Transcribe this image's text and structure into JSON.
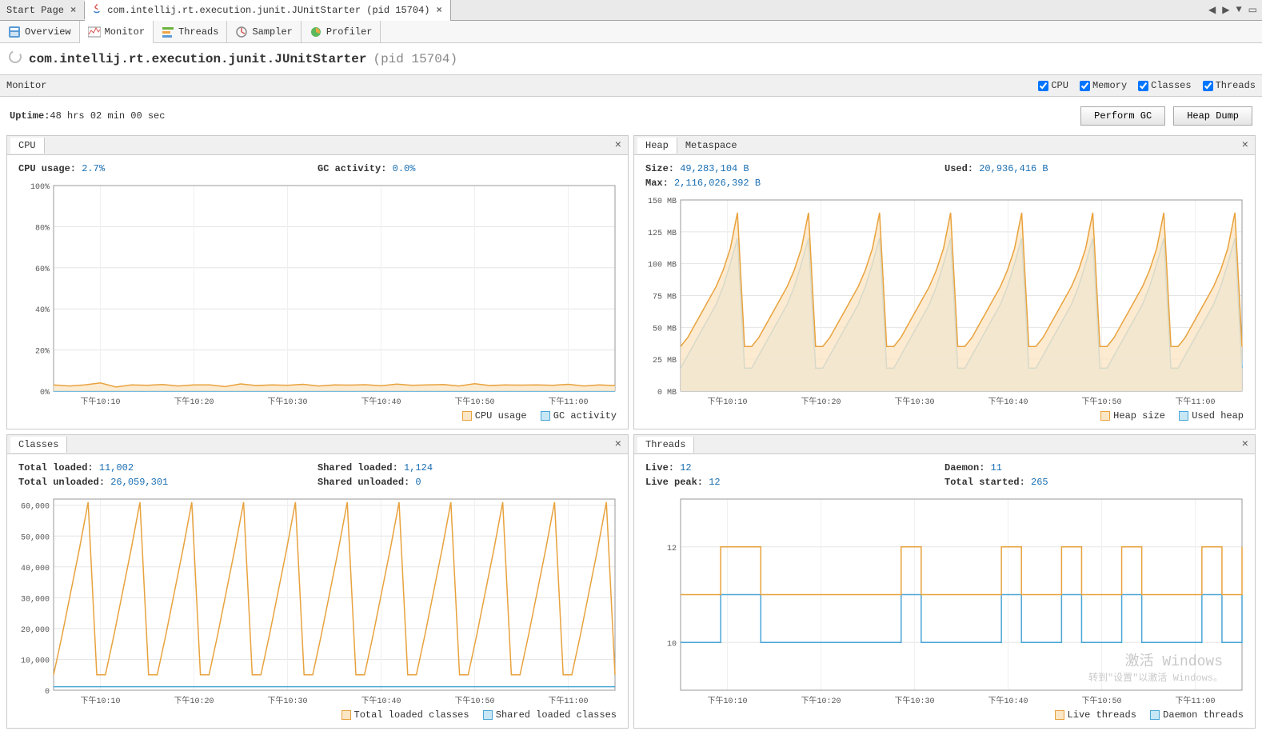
{
  "top_tabs": {
    "start_page": "Start Page",
    "main": "com.intellij.rt.execution.junit.JUnitStarter (pid 15704)"
  },
  "tool_tabs": {
    "overview": "Overview",
    "monitor": "Monitor",
    "threads": "Threads",
    "sampler": "Sampler",
    "profiler": "Profiler"
  },
  "title": {
    "name": "com.intellij.rt.execution.junit.JUnitStarter",
    "pid": "(pid 15704)"
  },
  "monitor_bar": {
    "label": "Monitor",
    "cpu": "CPU",
    "memory": "Memory",
    "classes": "Classes",
    "threads": "Threads"
  },
  "uptime": {
    "label": "Uptime: ",
    "value": "48 hrs 02 min 00 sec"
  },
  "buttons": {
    "gc": "Perform GC",
    "dump": "Heap Dump"
  },
  "panel_cpu": {
    "title": "CPU",
    "cpu_usage_label": "CPU usage: ",
    "cpu_usage_value": "2.7%",
    "gc_label": "GC activity: ",
    "gc_value": "0.0%",
    "legend_cpu": "CPU usage",
    "legend_gc": "GC activity"
  },
  "panel_heap": {
    "tab_heap": "Heap",
    "tab_meta": "Metaspace",
    "size_label": "Size: ",
    "size_value": "49,283,104 B",
    "used_label": "Used: ",
    "used_value": "20,936,416 B",
    "max_label": "Max: ",
    "max_value": "2,116,026,392 B",
    "legend_size": "Heap size",
    "legend_used": "Used heap"
  },
  "panel_classes": {
    "title": "Classes",
    "tl_label": "Total loaded: ",
    "tl_value": "11,002",
    "sl_label": "Shared loaded: ",
    "sl_value": "1,124",
    "tu_label": "Total unloaded: ",
    "tu_value": "26,059,301",
    "su_label": "Shared unloaded: ",
    "su_value": "0",
    "legend_total": "Total loaded classes",
    "legend_shared": "Shared loaded classes"
  },
  "panel_threads": {
    "title": "Threads",
    "live_label": "Live: ",
    "live_value": "12",
    "daemon_label": "Daemon: ",
    "daemon_value": "11",
    "peak_label": "Live peak: ",
    "peak_value": "12",
    "started_label": "Total started: ",
    "started_value": "265",
    "legend_live": "Live threads",
    "legend_daemon": "Daemon threads"
  },
  "watermark": {
    "l1": "激活 Windows",
    "l2": "转到\"设置\"以激活 Windows。"
  },
  "chart_data": [
    {
      "id": "cpu",
      "type": "line",
      "xlabel": "",
      "ylabel": "",
      "x_ticks": [
        "下午10:10",
        "下午10:20",
        "下午10:30",
        "下午10:40",
        "下午10:50",
        "下午11:00"
      ],
      "y_ticks": [
        0,
        20,
        40,
        60,
        80,
        100
      ],
      "y_suffix": "%",
      "ylim": [
        0,
        100
      ],
      "series": [
        {
          "name": "CPU usage",
          "color": "#e8a23d",
          "fill": "#fbe6c5",
          "values": [
            3,
            2.5,
            3,
            4,
            2,
            3,
            2.8,
            3.2,
            2.5,
            3,
            3,
            2.2,
            3.5,
            2.7,
            3,
            2.8,
            3.3,
            2.5,
            3,
            2.9,
            3.1,
            2.6,
            3.4,
            2.8,
            3,
            3.2,
            2.5,
            3.6,
            2.7,
            3,
            2.9,
            3,
            2.8,
            3.3,
            2.5,
            3,
            2.7
          ]
        },
        {
          "name": "GC activity",
          "color": "#4aa6d6",
          "fill": "#c7e7f6",
          "values": [
            0,
            0,
            0,
            0,
            0,
            0,
            0,
            0,
            0,
            0,
            0,
            0,
            0,
            0,
            0,
            0,
            0,
            0,
            0,
            0,
            0,
            0,
            0,
            0,
            0,
            0,
            0,
            0,
            0,
            0,
            0,
            0,
            0,
            0,
            0,
            0,
            0
          ]
        }
      ]
    },
    {
      "id": "heap",
      "type": "area",
      "xlabel": "",
      "ylabel": "",
      "x_ticks": [
        "下午10:10",
        "下午10:20",
        "下午10:30",
        "下午10:40",
        "下午10:50",
        "下午11:00"
      ],
      "y_ticks": [
        0,
        25,
        50,
        75,
        100,
        125,
        150
      ],
      "y_suffix": " MB",
      "ylim": [
        0,
        150
      ],
      "cycles": 8,
      "series": [
        {
          "name": "Heap size",
          "color": "#e8a23d",
          "fill": "#fbe6c5",
          "pattern": [
            35,
            42,
            52,
            62,
            72,
            82,
            95,
            112,
            140,
            35
          ]
        },
        {
          "name": "Used heap",
          "color": "#4aa6d6",
          "fill": "#c7e7f6",
          "pattern": [
            18,
            28,
            38,
            48,
            58,
            68,
            82,
            100,
            120,
            18
          ]
        }
      ]
    },
    {
      "id": "classes",
      "type": "line",
      "x_ticks": [
        "下午10:10",
        "下午10:20",
        "下午10:30",
        "下午10:40",
        "下午10:50",
        "下午11:00"
      ],
      "y_ticks": [
        0,
        10000,
        20000,
        30000,
        40000,
        50000,
        60000
      ],
      "ylim": [
        0,
        62000
      ],
      "cycles": 11,
      "series": [
        {
          "name": "Total loaded classes",
          "color": "#e8a23d",
          "pattern": [
            5000,
            18000,
            32000,
            46000,
            61000,
            5000
          ]
        },
        {
          "name": "Shared loaded classes",
          "color": "#4aa6d6",
          "pattern": [
            1124,
            1124,
            1124,
            1124,
            1124,
            1124
          ]
        }
      ]
    },
    {
      "id": "threads",
      "type": "step",
      "x_ticks": [
        "下午10:10",
        "下午10:20",
        "下午10:30",
        "下午10:40",
        "下午10:50",
        "下午11:00"
      ],
      "y_ticks": [
        10,
        12
      ],
      "ylim": [
        9,
        13
      ],
      "series": [
        {
          "name": "Live threads",
          "color": "#e8a23d",
          "values": [
            11,
            11,
            12,
            12,
            11,
            11,
            11,
            11,
            11,
            11,
            11,
            12,
            11,
            11,
            11,
            11,
            12,
            11,
            11,
            12,
            11,
            11,
            12,
            11,
            11,
            11,
            12,
            11,
            12
          ]
        },
        {
          "name": "Daemon threads",
          "color": "#4aa6d6",
          "values": [
            10,
            10,
            11,
            11,
            10,
            10,
            10,
            10,
            10,
            10,
            10,
            11,
            10,
            10,
            10,
            10,
            11,
            10,
            10,
            11,
            10,
            10,
            11,
            10,
            10,
            10,
            11,
            10,
            11
          ]
        }
      ]
    }
  ]
}
